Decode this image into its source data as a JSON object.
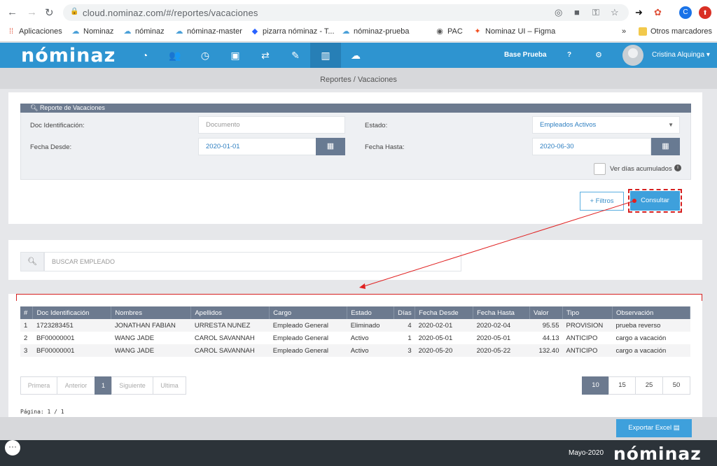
{
  "browser": {
    "url": "cloud.nominaz.com/#/reportes/vacaciones",
    "profile_initial": "C"
  },
  "bookmarks": [
    {
      "label": "Aplicaciones"
    },
    {
      "label": "Nominaz"
    },
    {
      "label": "nóminaz"
    },
    {
      "label": "nóminaz-master"
    },
    {
      "label": "pizarra nóminaz - T..."
    },
    {
      "label": "nóminaz-prueba"
    },
    {
      "label": "PAC"
    },
    {
      "label": "Nominaz UI – Figma"
    },
    {
      "label": "»"
    },
    {
      "label": "Otros marcadores"
    }
  ],
  "app": {
    "logo": "nóminaz",
    "company": "Base Prueba",
    "help": "?",
    "user": "Cristina Alquinga ▾"
  },
  "breadcrumb": "Reportes / Vacaciones",
  "filters": {
    "title": "Reporte de Vacaciones",
    "doc_label": "Doc Identificación:",
    "doc_placeholder": "Documento",
    "estado_label": "Estado:",
    "estado_value": "Empleados Activos",
    "desde_label": "Fecha Desde:",
    "desde_value": "2020-01-01",
    "hasta_label": "Fecha Hasta:",
    "hasta_value": "2020-06-30",
    "acum_label": "Ver días acumulados",
    "filtros_btn": "+ Filtros",
    "consultar_btn": "Consultar"
  },
  "search": {
    "placeholder": "BUSCAR EMPLEADO"
  },
  "table": {
    "headers": [
      "#",
      "Doc Identificación",
      "Nombres",
      "Apellidos",
      "Cargo",
      "Estado",
      "Días",
      "Fecha Desde",
      "Fecha Hasta",
      "Valor",
      "Tipo",
      "Observación"
    ],
    "rows": [
      [
        "1",
        "1723283451",
        "JONATHAN FABIAN",
        "URRESTA NUNEZ",
        "Empleado General",
        "Eliminado",
        "4",
        "2020-02-01",
        "2020-02-04",
        "95.55",
        "PROVISION",
        "prueba reverso"
      ],
      [
        "2",
        "BF00000001",
        "WANG JADE",
        "CAROL SAVANNAH",
        "Empleado General",
        "Activo",
        "1",
        "2020-05-01",
        "2020-05-01",
        "44.13",
        "ANTICIPO",
        "cargo a vacación"
      ],
      [
        "3",
        "BF00000001",
        "WANG JADE",
        "CAROL SAVANNAH",
        "Empleado General",
        "Activo",
        "3",
        "2020-05-20",
        "2020-05-22",
        "132.40",
        "ANTICIPO",
        "cargo a vacación"
      ]
    ]
  },
  "pagination": {
    "first": "Primera",
    "prev": "Anterior",
    "current": "1",
    "next": "Siguiente",
    "last": "Ultima",
    "sizes": [
      "10",
      "15",
      "25",
      "50"
    ],
    "selected_size": "10",
    "page_info": "Página: 1 / 1"
  },
  "export_btn": "Exportar Excel",
  "footer": {
    "date": "Mayo-2020",
    "logo": "nóminaz"
  },
  "colors": {
    "brand": "#2e94d0",
    "header_gray": "#6c7a8f",
    "annotation": "#e02020"
  }
}
